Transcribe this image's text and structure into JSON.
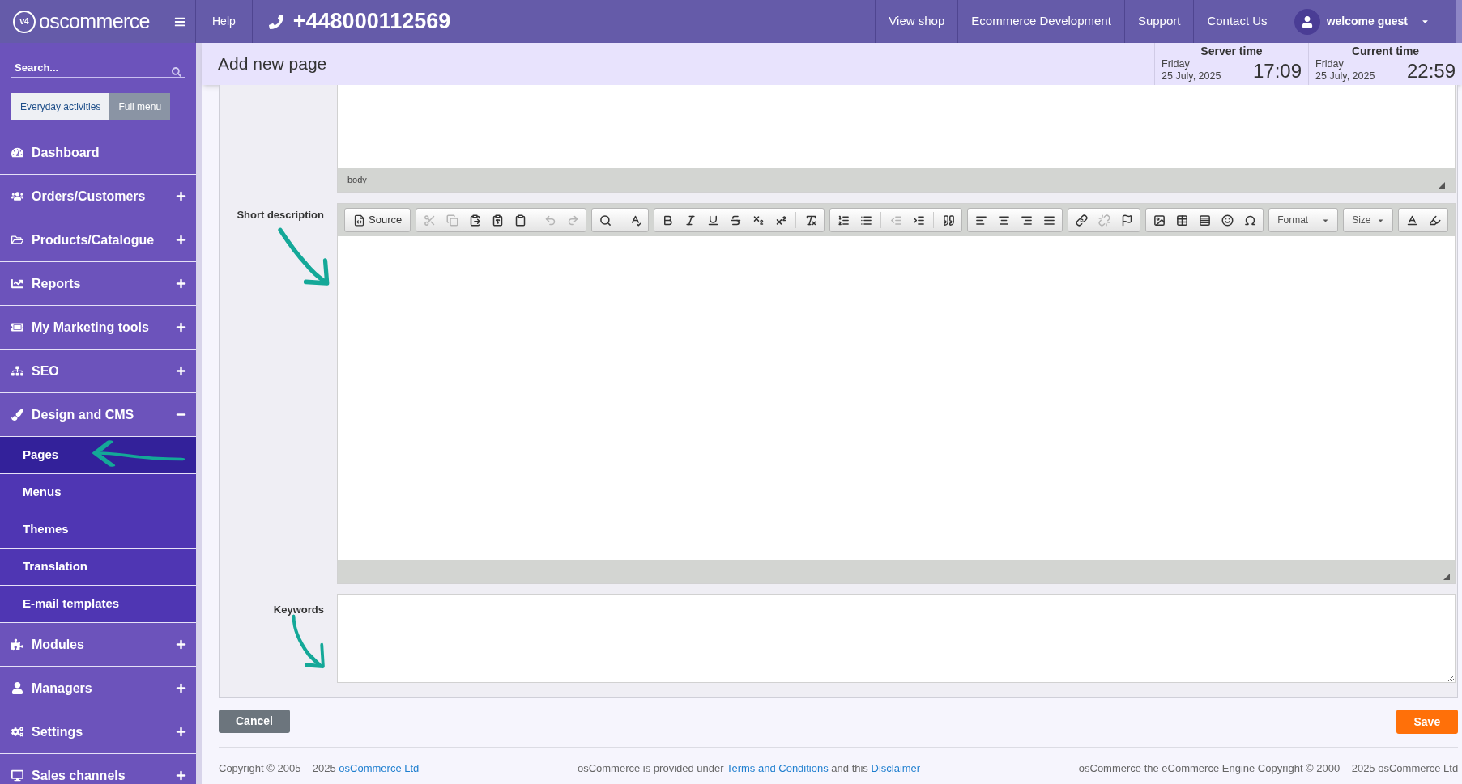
{
  "header": {
    "logo_badge": "v4",
    "logo": "oscommerce",
    "help": "Help",
    "phone": "+448000112569",
    "links": [
      {
        "label": "View shop"
      },
      {
        "label": "Ecommerce Development"
      },
      {
        "label": "Support"
      },
      {
        "label": "Contact Us"
      }
    ],
    "user": "welcome guest"
  },
  "page_title": "Add new page",
  "clocks": [
    {
      "label": "Server time",
      "day": "Friday",
      "date": "25 July, 2025",
      "time": "17:09"
    },
    {
      "label": "Current time",
      "day": "Friday",
      "date": "25 July, 2025",
      "time": "22:59"
    }
  ],
  "sidebar": {
    "search": {
      "placeholder": "Search..."
    },
    "modes": [
      {
        "label": "Everyday activities",
        "selected": true
      },
      {
        "label": "Full menu",
        "selected": false
      }
    ],
    "items": [
      {
        "kind": "link",
        "label": "Dashboard"
      },
      {
        "kind": "group",
        "label": "Orders/Customers",
        "expanded": false
      },
      {
        "kind": "group",
        "label": "Products/Catalogue",
        "expanded": false
      },
      {
        "kind": "group",
        "label": "Reports",
        "expanded": false
      },
      {
        "kind": "group",
        "label": "My Marketing tools",
        "expanded": false
      },
      {
        "kind": "group",
        "label": "SEO",
        "expanded": false
      },
      {
        "kind": "group",
        "label": "Design and CMS",
        "expanded": true,
        "children": [
          {
            "label": "Pages",
            "selected": true
          },
          {
            "label": "Menus",
            "selected": false
          },
          {
            "label": "Themes",
            "selected": false
          },
          {
            "label": "Translation",
            "selected": false
          },
          {
            "label": "E-mail templates",
            "selected": false
          }
        ]
      },
      {
        "kind": "group",
        "label": "Modules",
        "expanded": false
      },
      {
        "kind": "group",
        "label": "Managers",
        "expanded": false
      },
      {
        "kind": "group",
        "label": "Settings",
        "expanded": false
      },
      {
        "kind": "group",
        "label": "Sales channels",
        "expanded": false
      }
    ]
  },
  "top_editor": {
    "path": "body"
  },
  "short_description": {
    "label": "Short description",
    "toolbar": [
      [
        {
          "kind": "source",
          "label": "Source",
          "disabled": false
        }
      ],
      [
        {
          "kind": "cut",
          "disabled": true
        },
        {
          "kind": "copy",
          "disabled": true
        },
        {
          "kind": "paste",
          "disabled": false
        },
        {
          "kind": "paste-text",
          "disabled": false
        },
        {
          "kind": "paste-word",
          "disabled": false
        },
        {
          "kind": "sep"
        },
        {
          "kind": "undo",
          "disabled": true
        },
        {
          "kind": "redo",
          "disabled": true
        }
      ],
      [
        {
          "kind": "find",
          "disabled": false
        },
        {
          "kind": "sep"
        },
        {
          "kind": "spell",
          "disabled": false
        }
      ],
      [
        {
          "kind": "bold",
          "disabled": false
        },
        {
          "kind": "italic",
          "disabled": false
        },
        {
          "kind": "underline",
          "disabled": false
        },
        {
          "kind": "strike",
          "disabled": false
        },
        {
          "kind": "sub",
          "disabled": false
        },
        {
          "kind": "sup",
          "disabled": false
        },
        {
          "kind": "sep"
        },
        {
          "kind": "clear",
          "disabled": false
        }
      ],
      [
        {
          "kind": "ol",
          "disabled": false
        },
        {
          "kind": "ul",
          "disabled": false
        },
        {
          "kind": "sep"
        },
        {
          "kind": "outdent",
          "disabled": true
        },
        {
          "kind": "indent",
          "disabled": false
        },
        {
          "kind": "sep"
        },
        {
          "kind": "quote",
          "disabled": false
        }
      ],
      [
        {
          "kind": "left",
          "disabled": false
        },
        {
          "kind": "center",
          "disabled": false
        },
        {
          "kind": "right",
          "disabled": false
        },
        {
          "kind": "justify",
          "disabled": false
        }
      ],
      [
        {
          "kind": "link",
          "disabled": false
        },
        {
          "kind": "unlink",
          "disabled": true
        },
        {
          "kind": "anchor",
          "disabled": false
        }
      ],
      [
        {
          "kind": "image",
          "disabled": false
        },
        {
          "kind": "table",
          "disabled": false
        },
        {
          "kind": "hr",
          "disabled": false
        },
        {
          "kind": "smiley",
          "disabled": false
        },
        {
          "kind": "special",
          "disabled": false
        }
      ],
      [
        {
          "kind": "combo",
          "label": "Format",
          "disabled": false
        }
      ],
      [
        {
          "kind": "combo",
          "label": "Size",
          "disabled": false
        }
      ],
      [
        {
          "kind": "textcolor",
          "disabled": false
        },
        {
          "kind": "bgcolor",
          "disabled": false
        }
      ]
    ]
  },
  "keywords": {
    "label": "Keywords"
  },
  "actions": {
    "cancel": "Cancel",
    "save": "Save"
  },
  "footer": {
    "copyright": "Copyright © 2005 – 2025",
    "copyright_link": "osCommerce Ltd",
    "terms_before": "osCommerce is provided under",
    "terms_link": "Terms and Conditions",
    "terms_middle": "and this",
    "disclaimer_link": "Disclaimer",
    "engine": "osCommerce the eCommerce Engine Copyright © 2000 – 2025 osCommerce Ltd"
  }
}
